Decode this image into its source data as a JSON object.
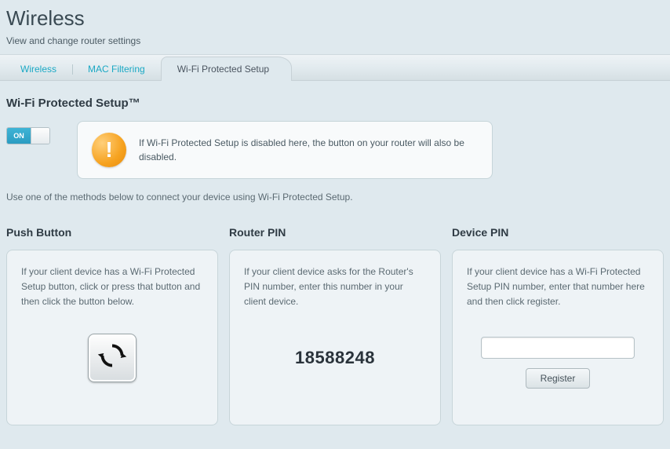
{
  "header": {
    "title": "Wireless",
    "subtitle": "View and change router settings"
  },
  "tabs": [
    {
      "label": "Wireless",
      "active": false
    },
    {
      "label": "MAC Filtering",
      "active": false
    },
    {
      "label": "Wi-Fi Protected Setup",
      "active": true
    }
  ],
  "section_title": "Wi-Fi Protected Setup™",
  "toggle": {
    "state": "ON"
  },
  "info_text": "If Wi-Fi Protected Setup is disabled here, the button on your router will also be disabled.",
  "instructions": "Use one of the methods below to connect your device using Wi-Fi Protected Setup.",
  "push_button": {
    "heading": "Push Button",
    "text": "If your client device has a Wi-Fi Protected Setup button, click or press that button and then click the button below."
  },
  "router_pin": {
    "heading": "Router PIN",
    "text": "If your client device asks for the Router's PIN number, enter this number in your client device.",
    "value": "18588248"
  },
  "device_pin": {
    "heading": "Device PIN",
    "text": "If your client device has a Wi-Fi Protected Setup PIN number, enter that number here and then click register.",
    "input_value": "",
    "register_label": "Register"
  }
}
